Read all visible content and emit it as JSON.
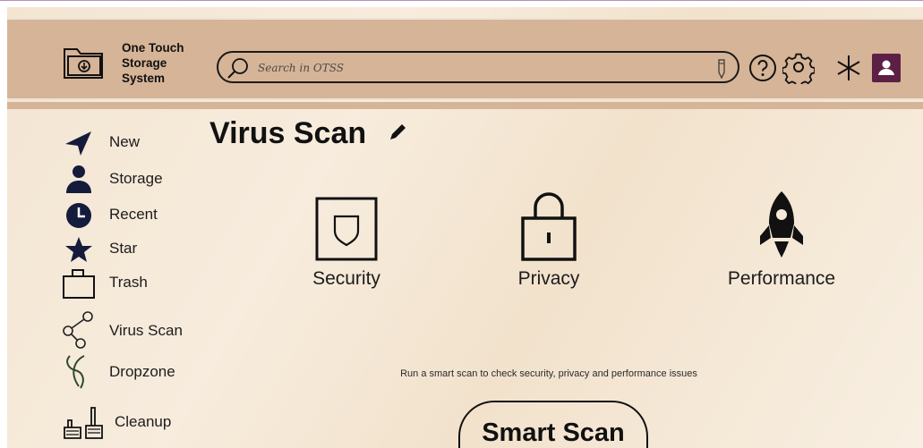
{
  "app": {
    "brand_lines": [
      "One Touch",
      "Storage",
      "System"
    ]
  },
  "header": {
    "search_placeholder": "Search in OTSS",
    "icons": [
      "folder-download-icon",
      "search-icon",
      "pen-icon",
      "help-icon",
      "gear-icon",
      "asterisk-icon",
      "user-avatar-icon"
    ]
  },
  "sidebar": {
    "items": [
      {
        "label": "New",
        "icon": "paper-plane-icon"
      },
      {
        "label": "Storage",
        "icon": "person-icon"
      },
      {
        "label": "Recent",
        "icon": "clock-icon"
      },
      {
        "label": "Star",
        "icon": "star-icon"
      },
      {
        "label": "Trash",
        "icon": "trash-box-icon"
      },
      {
        "label": "Virus Scan",
        "icon": "share-nodes-icon"
      },
      {
        "label": "Dropzone",
        "icon": "dropzone-icon"
      },
      {
        "label": "Cleanup",
        "icon": "broom-icon"
      }
    ]
  },
  "main": {
    "title": "Virus Scan",
    "tiles": [
      {
        "label": "Security",
        "icon": "shield-icon"
      },
      {
        "label": "Privacy",
        "icon": "lock-icon"
      },
      {
        "label": "Performance",
        "icon": "rocket-icon"
      }
    ],
    "hint": "Run a smart scan to check security, privacy and performance issues",
    "smart_scan_label": "Smart Scan"
  },
  "colors": {
    "header_bg": "#d6b497",
    "avatar_bg": "#5c1f45",
    "page_bg": "#f3e5d2"
  }
}
